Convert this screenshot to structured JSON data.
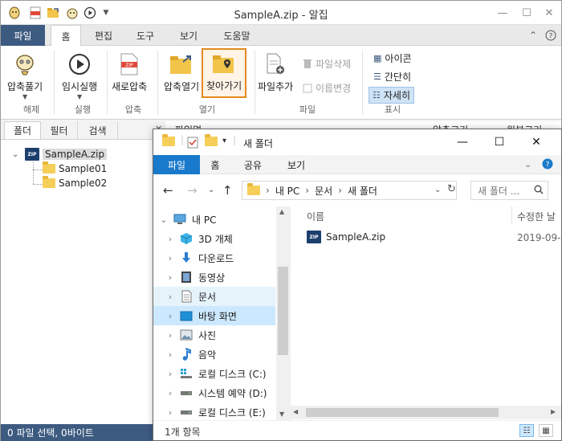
{
  "alzip": {
    "window_title": "SampleA.zip - 알집",
    "menu_tabs": [
      "파일",
      "홈",
      "편집",
      "도구",
      "보기",
      "도움말"
    ],
    "ribbon": {
      "compress": "압축풀기",
      "temp_run": "임시실행",
      "new_compress": "새로압축",
      "open_compress": "압축열기",
      "find": "찾아가기",
      "add_file": "파일추가",
      "delete_file": "파일삭제",
      "rename": "이름변경",
      "view_icons": "아이콘",
      "view_simple": "간단히",
      "view_detail": "자세히",
      "groups": {
        "extract": "해제",
        "run": "실행",
        "compress": "압축",
        "open": "열기",
        "file": "파일",
        "display": "표시"
      }
    },
    "left_tabs": [
      "폴더",
      "필터",
      "검색"
    ],
    "tree": {
      "root": "SampleA.zip",
      "children": [
        "Sample01",
        "Sample02"
      ]
    },
    "columns": {
      "name": "파일명",
      "comp_size": "압축크기",
      "orig_size": "원본크기"
    },
    "status": "0 파일 선택,  0바이트"
  },
  "explorer": {
    "title": "새 폴더",
    "menu_tabs": [
      "파일",
      "홈",
      "공유",
      "보기"
    ],
    "path": [
      "내 PC",
      "문서",
      "새 폴더"
    ],
    "search_placeholder": "새 폴더 ...",
    "nav": [
      {
        "label": "내 PC",
        "icon": "pc-icon"
      },
      {
        "label": "3D 개체",
        "icon": "cube-icon"
      },
      {
        "label": "다운로드",
        "icon": "download-icon"
      },
      {
        "label": "동영상",
        "icon": "video-icon"
      },
      {
        "label": "문서",
        "icon": "document-icon"
      },
      {
        "label": "바탕 화면",
        "icon": "desktop-icon"
      },
      {
        "label": "사진",
        "icon": "pictures-icon"
      },
      {
        "label": "음악",
        "icon": "music-icon"
      },
      {
        "label": "로컬 디스크 (C:)",
        "icon": "drive-icon"
      },
      {
        "label": "시스템 예약 (D:)",
        "icon": "drive-icon"
      },
      {
        "label": "로컬 디스크 (E:)",
        "icon": "drive-icon"
      }
    ],
    "columns": {
      "name": "이름",
      "modified": "수정한 날"
    },
    "files": [
      {
        "name": "SampleA.zip",
        "modified": "2019-09-"
      }
    ],
    "status": "1개 항목"
  }
}
